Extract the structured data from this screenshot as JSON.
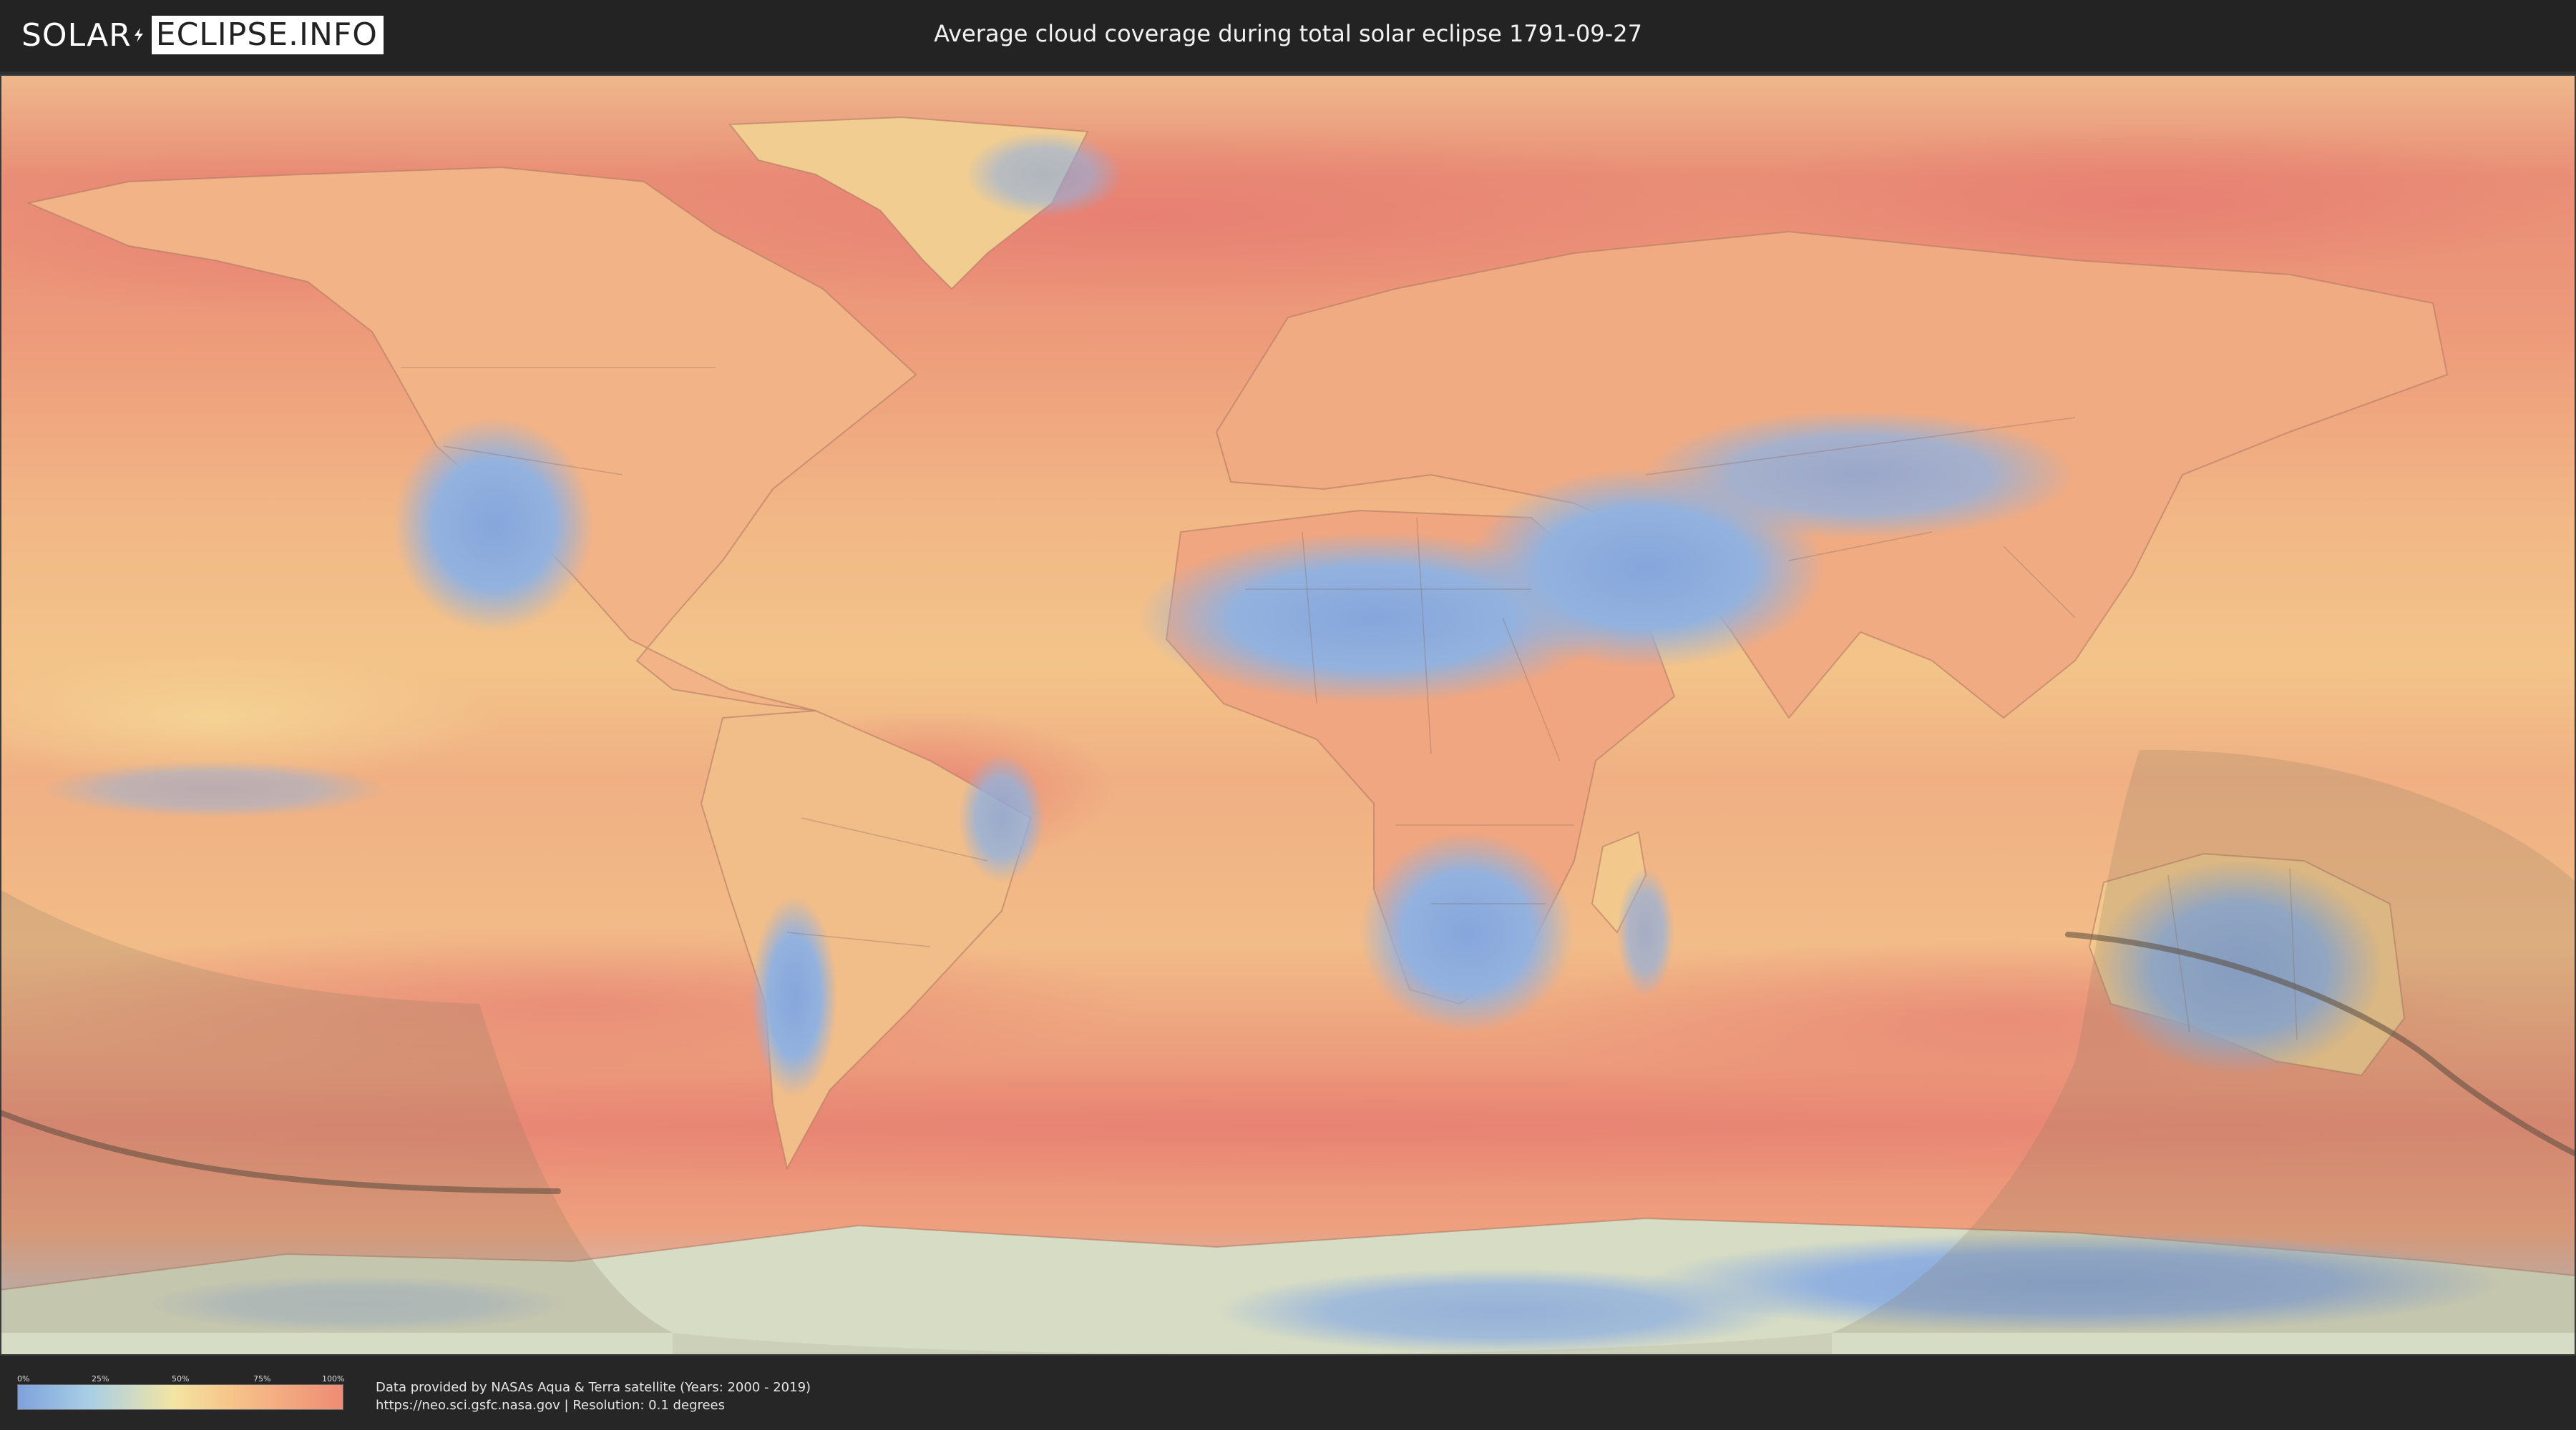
{
  "header": {
    "logo_solar": "SOLAR",
    "logo_eclipse": "ECLIPSE.INFO",
    "title": "Average cloud coverage during total solar eclipse 1791-09-27"
  },
  "legend": {
    "ticks": [
      "0%",
      "25%",
      "50%",
      "75%",
      "100%"
    ],
    "color_low": "#7fa1dd",
    "color_mid": "#f3e4a3",
    "color_high": "#ee8c74"
  },
  "credits": {
    "line1": "Data provided by NASAs Aqua & Terra satellite (Years: 2000 - 2019)",
    "line2": "https://neo.sci.gsfc.nasa.gov | Resolution: 0.1 degrees"
  },
  "map": {
    "projection": "equirectangular",
    "ocean_color": "#f1a77d",
    "cloudy_color": "#e98574",
    "clear_color": "#86a6dc",
    "shadow_overlay_color": "#8a7a60",
    "eclipse_path_color": "#5a4a3c"
  }
}
